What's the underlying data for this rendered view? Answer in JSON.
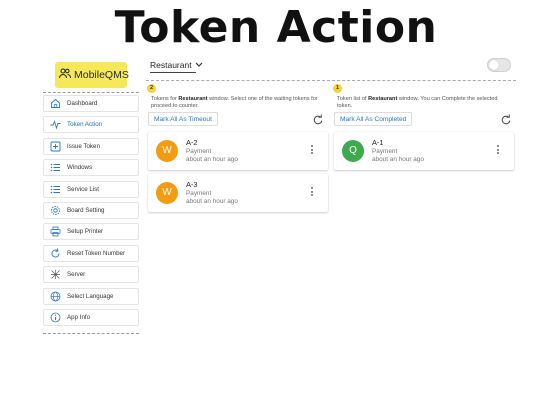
{
  "headline": "Token Action",
  "colors": {
    "accent": "#2a78c2",
    "logo_bg": "#f5e85a",
    "badge": "#f3d23a",
    "avatar_waiting": "#f39c12",
    "avatar_queued": "#3fa950"
  },
  "sidebar": {
    "logo_text": "MobileQMS",
    "logo_icon": "users-icon",
    "active_item": "Token Action",
    "items": [
      {
        "label": "Dashboard",
        "icon": "home-icon"
      },
      {
        "label": "Token Action",
        "icon": "activity-icon"
      },
      {
        "label": "Issue Token",
        "icon": "plus-box-icon"
      },
      {
        "label": "Windows",
        "icon": "list-icon"
      },
      {
        "label": "Service List",
        "icon": "list-icon"
      },
      {
        "label": "Board Setting",
        "icon": "gear-icon"
      },
      {
        "label": "Setup Printer",
        "icon": "printer-icon"
      },
      {
        "label": "Reset Token Number",
        "icon": "refresh-icon"
      },
      {
        "label": "Server",
        "icon": "network-icon"
      },
      {
        "label": "Select Language",
        "icon": "globe-icon"
      },
      {
        "label": "App Info",
        "icon": "info-icon"
      }
    ]
  },
  "topbar": {
    "window_select": "Restaurant",
    "toggle_on": false
  },
  "left_panel": {
    "badge": "2",
    "desc_prefix": "Tokens for ",
    "desc_window": "Restaurant",
    "desc_suffix": " window. Select one of the waiting tokens for proceed to counter.",
    "action_label": "Mark All As Timeout",
    "tokens": [
      {
        "avatar": "W",
        "number": "A-2",
        "service": "Payment",
        "time": "about an hour ago"
      },
      {
        "avatar": "W",
        "number": "A-3",
        "service": "Payment",
        "time": "about an hour ago"
      }
    ]
  },
  "right_panel": {
    "badge": "1",
    "desc_prefix": "Token list of ",
    "desc_window": "Restaurant",
    "desc_suffix": " window. You can Complete the selected token.",
    "action_label": "Mark All As Completed",
    "tokens": [
      {
        "avatar": "Q",
        "number": "A-1",
        "service": "Payment",
        "time": "about an hour ago"
      }
    ]
  }
}
